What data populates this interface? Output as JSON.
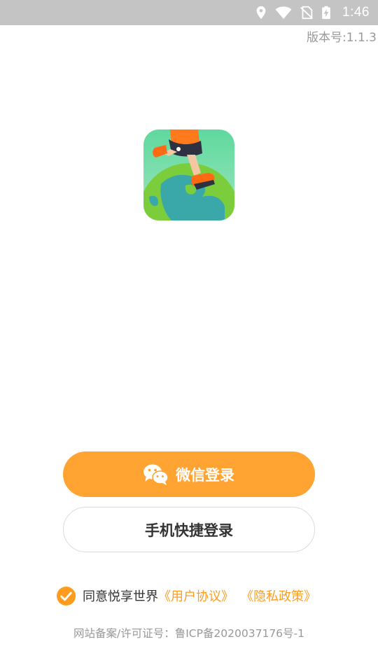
{
  "status_bar": {
    "time": "1:46",
    "icons": [
      "location-icon",
      "wifi-icon",
      "no-sim-icon",
      "battery-charging-icon"
    ]
  },
  "version_label": "版本号:1.1.3",
  "app_icon": {
    "name": "app-logo-icon"
  },
  "login": {
    "wechat_label": "微信登录",
    "phone_label": "手机快捷登录"
  },
  "agreement": {
    "checked": true,
    "prefix": "同意悦享世界",
    "user_agreement": "《用户协议》",
    "privacy_policy": "《隐私政策》"
  },
  "icp_label": "网站备案/许可证号：鲁ICP备2020037176号-1",
  "colors": {
    "accent": "#ffa333",
    "link": "#ff9c1e",
    "status_bar": "#c4c4c4",
    "muted_text": "#999999"
  }
}
